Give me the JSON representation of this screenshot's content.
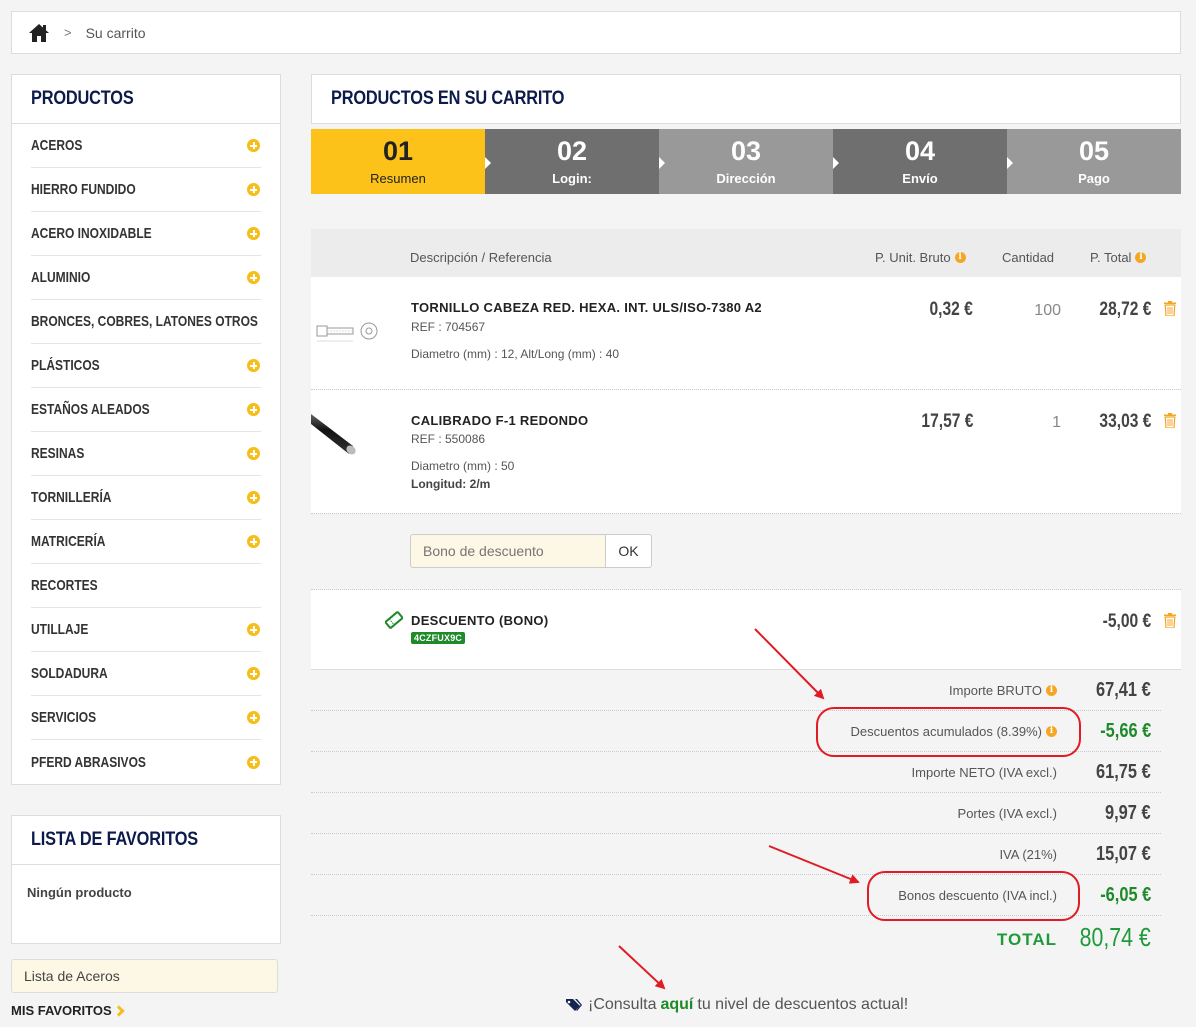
{
  "breadcrumb": {
    "separator": ">",
    "current": "Su carrito"
  },
  "sidebar": {
    "products_title": "PRODUCTOS",
    "categories": [
      {
        "label": "ACEROS",
        "expandable": true
      },
      {
        "label": "HIERRO FUNDIDO",
        "expandable": true
      },
      {
        "label": "ACERO INOXIDABLE",
        "expandable": true
      },
      {
        "label": "ALUMINIO",
        "expandable": true
      },
      {
        "label": "BRONCES, COBRES, LATONES OTROS",
        "expandable": true
      },
      {
        "label": "PLÁSTICOS",
        "expandable": true
      },
      {
        "label": "ESTAÑOS ALEADOS",
        "expandable": true
      },
      {
        "label": "RESINAS",
        "expandable": true
      },
      {
        "label": "TORNILLERÍA",
        "expandable": true
      },
      {
        "label": "MATRICERÍA",
        "expandable": true
      },
      {
        "label": "RECORTES",
        "expandable": false
      },
      {
        "label": "UTILLAJE",
        "expandable": true
      },
      {
        "label": "SOLDADURA",
        "expandable": true
      },
      {
        "label": "SERVICIOS",
        "expandable": true
      },
      {
        "label": "PFERD ABRASIVOS",
        "expandable": true
      }
    ],
    "favorites_title": "LISTA DE FAVORITOS",
    "favorites_empty": "Ningún producto",
    "favorites_list_value": "Lista de Aceros",
    "my_favorites": "MIS FAVORITOS"
  },
  "cart": {
    "title": "PRODUCTOS EN SU CARRITO",
    "steps": [
      {
        "num": "01",
        "label": "Resumen",
        "active": true
      },
      {
        "num": "02",
        "label": "Login:",
        "active": false
      },
      {
        "num": "03",
        "label": "Dirección",
        "active": false
      },
      {
        "num": "04",
        "label": "Envío",
        "active": false
      },
      {
        "num": "05",
        "label": "Pago",
        "active": false
      }
    ],
    "headers": {
      "description": "Descripción / Referencia",
      "unit_price": "P. Unit. Bruto",
      "quantity": "Cantidad",
      "total": "P. Total"
    },
    "items": [
      {
        "name": "TORNILLO CABEZA RED. HEXA. INT. ULS/ISO-7380 A2",
        "ref": "REF : 704567",
        "attrs": "Diametro (mm) : 12, Alt/Long (mm) : 40",
        "unit_price": "0,32 €",
        "quantity": "100",
        "total": "28,72 €"
      },
      {
        "name": "CALIBRADO F-1 REDONDO",
        "ref": "REF : 550086",
        "attrs": "Diametro (mm) : 50",
        "attrs2": "Longitud: 2/m",
        "unit_price": "17,57 €",
        "quantity": "1",
        "total": "33,03 €"
      }
    ],
    "coupon": {
      "placeholder": "Bono de descuento",
      "button": "OK"
    },
    "discount": {
      "label": "DESCUENTO (BONO)",
      "code": "4CZFUX9C",
      "amount": "-5,00 €"
    },
    "totals": [
      {
        "label": "Importe BRUTO",
        "value": "67,41 €",
        "info": true,
        "green": false
      },
      {
        "label": "Descuentos acumulados (8.39%)",
        "value": "-5,66 €",
        "info": true,
        "green": true
      },
      {
        "label": "Importe NETO (IVA excl.)",
        "value": "61,75 €",
        "info": false,
        "green": false
      },
      {
        "label": "Portes (IVA excl.)",
        "value": "9,97 €",
        "info": false,
        "green": false
      },
      {
        "label": "IVA (21%)",
        "value": "15,07 €",
        "info": false,
        "green": false
      },
      {
        "label": "Bonos descuento (IVA incl.)",
        "value": "-6,05 €",
        "info": false,
        "green": true
      }
    ],
    "grand_total": {
      "label": "TOTAL",
      "value": "80,74 €"
    },
    "consult": {
      "pre": "¡Consulta",
      "link": "aquí",
      "post": "tu nivel de descuentos actual!"
    }
  },
  "colors": {
    "accent": "#fcc21a",
    "brand_navy": "#0d1b4b",
    "green": "#1e8a2a",
    "annotation_red": "#e01b24"
  }
}
